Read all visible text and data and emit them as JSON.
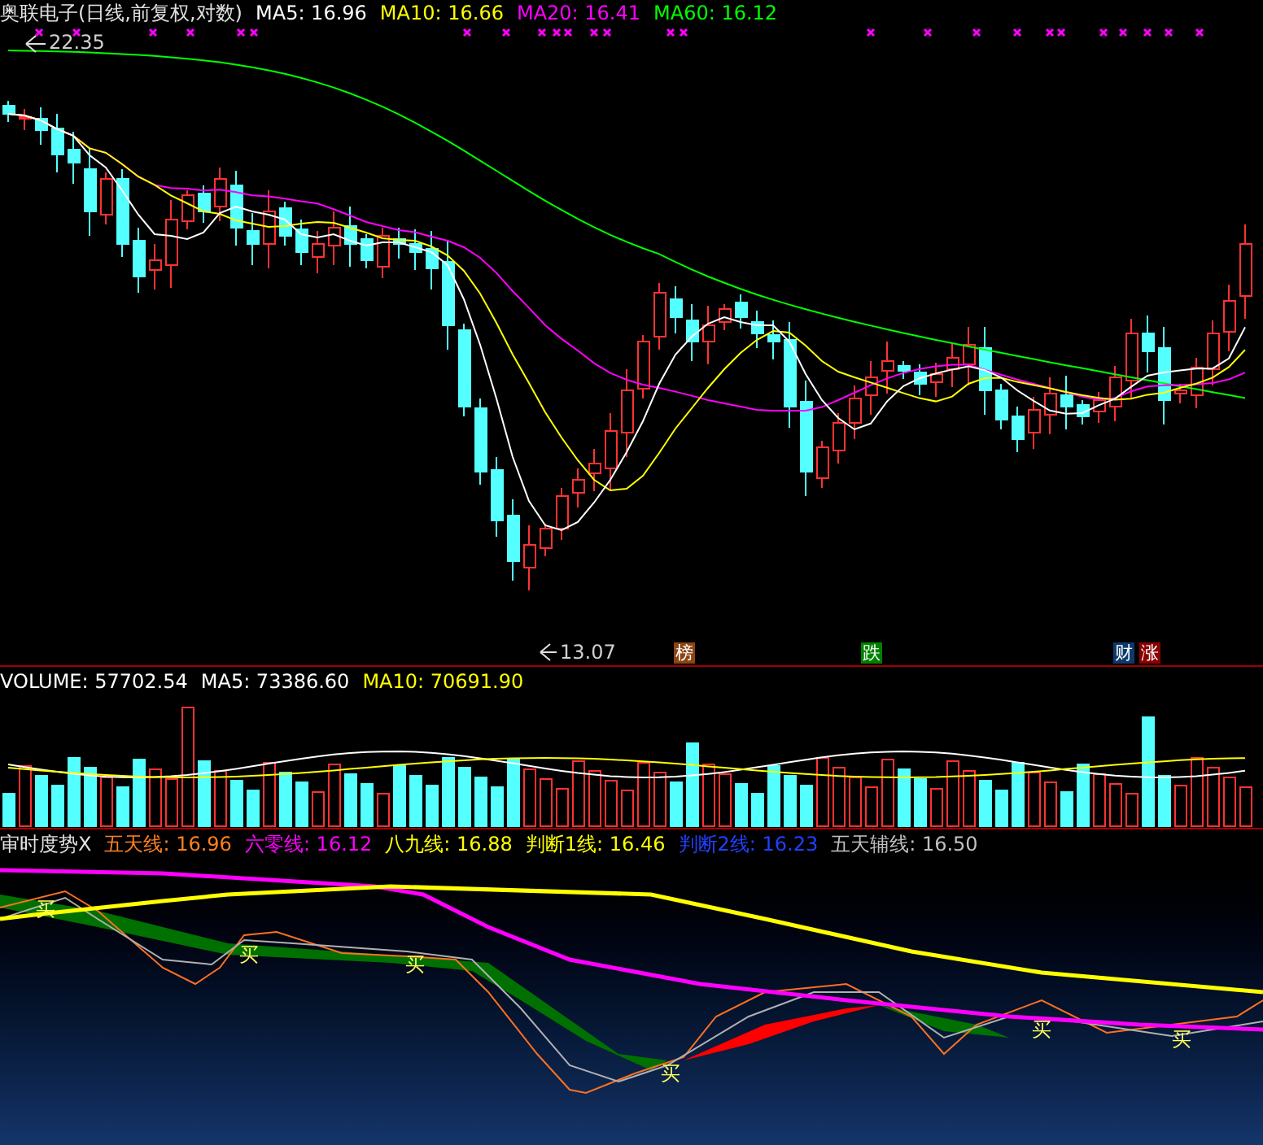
{
  "main_chart": {
    "title": "奥联电子(日线,前复权,对数)",
    "indicators": [
      {
        "label": "MA5: 16.96",
        "color": "#ffffff"
      },
      {
        "label": "MA10: 16.66",
        "color": "#ffff00"
      },
      {
        "label": "MA20: 16.41",
        "color": "#ff00ff"
      },
      {
        "label": "MA60: 16.12",
        "color": "#00ff00"
      }
    ],
    "high_label": "22.35",
    "low_label": "13.07",
    "event_markers": [
      {
        "label": "榜",
        "color": "#8b4513"
      },
      {
        "label": "跌",
        "color": "#008000"
      },
      {
        "label": "财",
        "color": "#0c3a6c"
      },
      {
        "label": "涨",
        "color": "#8b0000"
      }
    ]
  },
  "volume": {
    "label": "VOLUME: 57702.54",
    "indicators": [
      {
        "label": "MA5: 73386.60",
        "color": "#ffffff"
      },
      {
        "label": "MA10: 70691.90",
        "color": "#ffff00"
      }
    ]
  },
  "indicator_panel": {
    "title": "审时度势X",
    "lines": [
      {
        "label": "五天线: 16.96",
        "color": "#ff8020"
      },
      {
        "label": "六零线: 16.12",
        "color": "#ff00ff"
      },
      {
        "label": "八九线: 16.88",
        "color": "#ffff00"
      },
      {
        "label": "判断1线: 16.46",
        "color": "#ffff00"
      },
      {
        "label": "判断2线: 16.23",
        "color": "#2040ff"
      },
      {
        "label": "五天辅线: 16.50",
        "color": "#c0c0c0"
      }
    ],
    "buy_marks": [
      "买",
      "买",
      "买",
      "买",
      "买",
      "买"
    ]
  }
}
